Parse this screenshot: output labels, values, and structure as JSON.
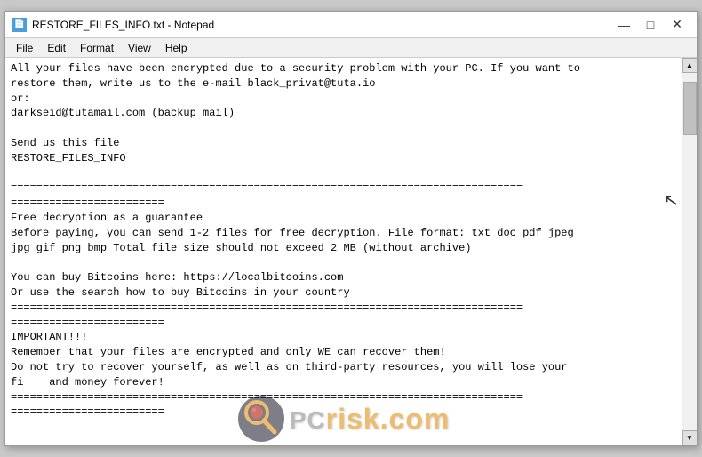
{
  "window": {
    "title": "RESTORE_FILES_INFO.txt - Notepad",
    "icon": "📄"
  },
  "title_bar": {
    "text": "RESTORE_FILES_INFO.txt - Notepad",
    "minimize_label": "—",
    "maximize_label": "□",
    "close_label": "✕"
  },
  "menu": {
    "items": [
      "File",
      "Edit",
      "Format",
      "View",
      "Help"
    ]
  },
  "content": {
    "text": "All your files have been encrypted due to a security problem with your PC. If you want to\nrestore them, write us to the e-mail black_privat@tuta.io\nor:\ndarkseid@tutamail.com (backup mail)\n\nSend us this file\nRESTORE_FILES_INFO\n\n================================================================================\n========================\nFree decryption as a guarantee\nBefore paying, you can send 1-2 files for free decryption. File format: txt doc pdf jpeg\njpg gif png bmp Total file size should not exceed 2 MB (without archive)\n\nYou can buy Bitcoins here: https://localbitcoins.com\nOr use the search how to buy Bitcoins in your country\n================================================================================\n========================\nIMPORTANT!!!\nRemember that your files are encrypted and only WE can recover them!\nDo not try to recover yourself, as well as on third-party resources, you will lose your\nfi    and money forever!\n================================================================================\n========================"
  },
  "watermark": {
    "text": "risk.com",
    "prefix": "PC"
  }
}
